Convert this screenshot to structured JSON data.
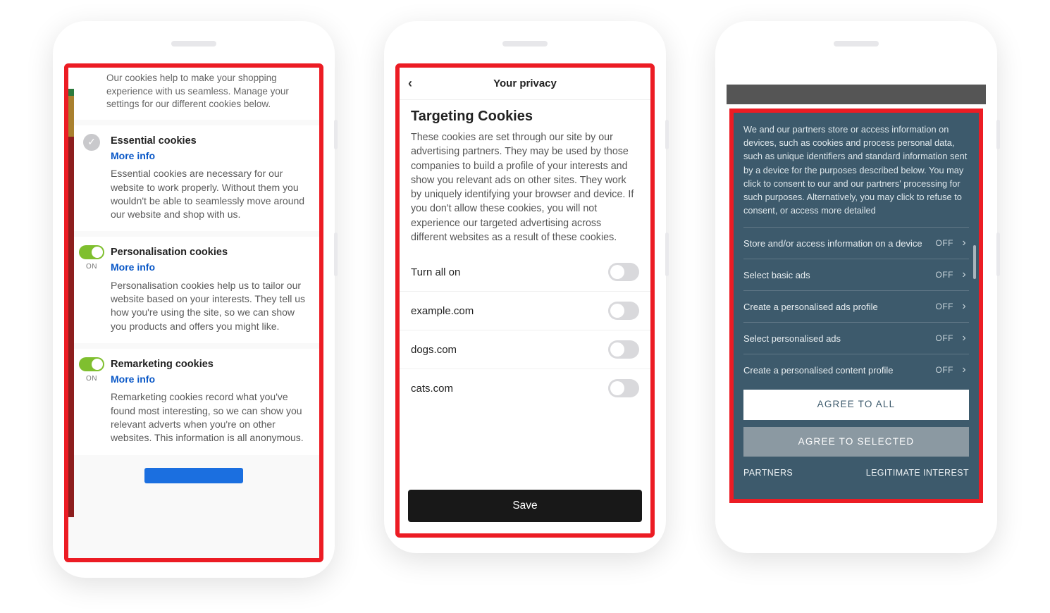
{
  "phone1": {
    "intro": "Our cookies help to make your shopping experience with us seamless. Manage your settings for our different cookies below.",
    "essential": {
      "title": "Essential cookies",
      "more": "More info",
      "body": "Essential cookies are necessary for our website to work properly. Without them you wouldn't be able to seamlessly move around our website and shop with us."
    },
    "personalisation": {
      "title": "Personalisation cookies",
      "state": "ON",
      "more": "More info",
      "body": "Personalisation cookies help us to tailor our website based on your interests. They tell us how you're using the site, so we can show you products and offers you might like."
    },
    "remarketing": {
      "title": "Remarketing cookies",
      "state": "ON",
      "more": "More info",
      "body": "Remarketing cookies record what you've found most interesting, so we can show you relevant adverts when you're on other websites. This information is all anonymous."
    }
  },
  "phone2": {
    "header": "Your privacy",
    "title": "Targeting Cookies",
    "desc": "These cookies are set through our site by our advertising partners. They may be used by those companies to build a profile of your interests and show you relevant ads on other sites. They work by uniquely identifying your browser and device. If you don't allow these cookies, you will not experience our targeted advertising across different websites as a result of these cookies.",
    "rows": [
      "Turn all on",
      "example.com",
      "dogs.com",
      "cats.com"
    ],
    "save": "Save"
  },
  "phone3": {
    "intro": "We and our partners store or access information on devices, such as cookies and process personal data, such as unique identifiers and standard information sent by a device for the purposes described below. You may click to consent to our and our partners' processing for such purposes. Alternatively, you may click to refuse to consent, or access more detailed",
    "off": "OFF",
    "options": [
      "Store and/or access information on a device",
      "Select basic ads",
      "Create a personalised ads profile",
      "Select personalised ads",
      "Create a personalised content profile"
    ],
    "agree_all": "AGREE TO ALL",
    "agree_selected": "AGREE TO SELECTED",
    "partners": "PARTNERS",
    "legit": "LEGITIMATE INTEREST"
  }
}
